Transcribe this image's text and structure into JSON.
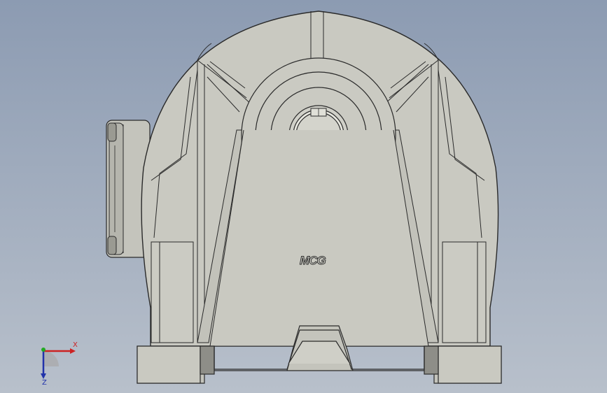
{
  "viewport": {
    "background_top": "#8c9bb2",
    "background_bottom": "#b8c0cb",
    "model_fill": "#c9c9c1",
    "model_shade": "#b8b8b0",
    "model_dark": "#8e8e88",
    "edge_color": "#2a2a2a"
  },
  "model": {
    "logo_text": "MCG"
  },
  "triad": {
    "x_label": "X",
    "z_label": "Z",
    "x_color": "#cc2222",
    "y_color": "#22aa22",
    "z_color": "#2233aa"
  }
}
